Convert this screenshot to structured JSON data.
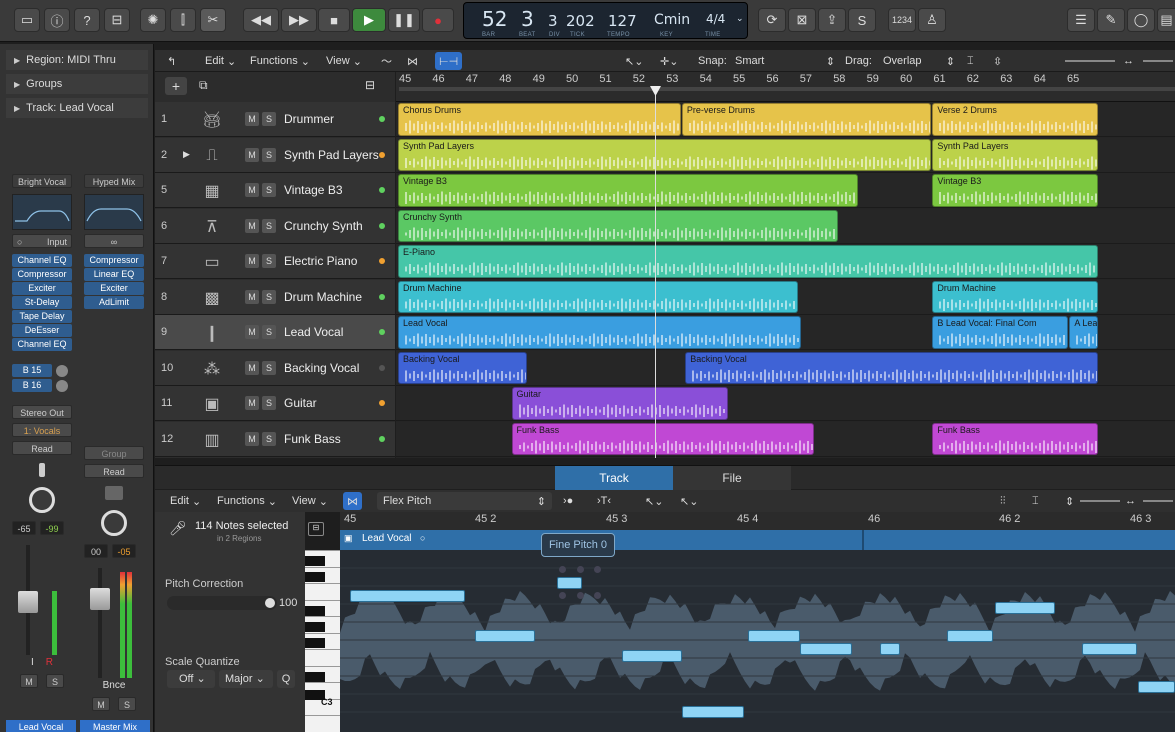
{
  "control_bar": {
    "lcd": {
      "bar": "52",
      "beat": "3",
      "div": "3",
      "tick": "202",
      "tempo": "127",
      "key": "Cmin",
      "time_sig": "4/4"
    },
    "lcd_labels": {
      "bar": "BAR",
      "beat": "BEAT",
      "div": "DIV",
      "tick": "TICK",
      "tempo": "TEMPO",
      "key": "KEY",
      "time": "TIME"
    },
    "count_in_label": "1234"
  },
  "inspector": {
    "region_label": "Region:",
    "region_value": "MIDI Thru",
    "groups_label": "Groups",
    "track_label": "Track:",
    "track_value": "Lead Vocal",
    "strip1": {
      "setting": "Bright Vocal",
      "input": "Input",
      "plugins": [
        "Channel EQ",
        "Compressor",
        "Exciter",
        "St-Delay",
        "Tape Delay",
        "DeEsser",
        "Channel EQ"
      ],
      "sends": [
        "B 15",
        "B 16"
      ],
      "output": "Stereo Out",
      "group": "1: Vocals",
      "automation": "Read",
      "pan_values": [
        "-65",
        "-99"
      ],
      "ir_labels": [
        "I",
        "R"
      ],
      "ms": [
        "M",
        "S"
      ],
      "name": "Lead Vocal"
    },
    "strip2": {
      "setting": "Hyped Mix",
      "plugins": [
        "Compressor",
        "Linear EQ",
        "Exciter",
        "AdLimit"
      ],
      "group": "Group",
      "automation": "Read",
      "pan_values": [
        "00",
        "-05"
      ],
      "bounce": "Bnce",
      "ms": [
        "M",
        "S"
      ],
      "name": "Master Mix"
    }
  },
  "tracks_toolbar": {
    "edit": "Edit",
    "functions": "Functions",
    "view": "View",
    "snap_label": "Snap:",
    "snap_value": "Smart",
    "drag_label": "Drag:",
    "drag_value": "Overlap"
  },
  "ruler": [
    "45",
    "46",
    "47",
    "48",
    "49",
    "50",
    "51",
    "52",
    "53",
    "54",
    "55",
    "56",
    "57",
    "58",
    "59",
    "60",
    "61",
    "62",
    "63",
    "64",
    "65"
  ],
  "tracks": [
    {
      "num": "1",
      "name": "Drummer",
      "icon": "drum-kit-icon",
      "dot": "#5fd15f"
    },
    {
      "num": "2",
      "name": "Synth Pad Layers",
      "icon": "synth-icon",
      "dot": "#f0a030"
    },
    {
      "num": "5",
      "name": "Vintage B3",
      "icon": "organ-icon",
      "dot": "#5fd15f"
    },
    {
      "num": "6",
      "name": "Crunchy Synth",
      "icon": "synth-stand-icon",
      "dot": "#5fd15f"
    },
    {
      "num": "7",
      "name": "Electric Piano",
      "icon": "piano-icon",
      "dot": "#f0a030"
    },
    {
      "num": "8",
      "name": "Drum Machine",
      "icon": "drum-machine-icon",
      "dot": "#5fd15f"
    },
    {
      "num": "9",
      "name": "Lead Vocal",
      "icon": "microphone-icon",
      "dot": "#5fd15f"
    },
    {
      "num": "10",
      "name": "Backing Vocal",
      "icon": "choir-icon",
      "dot": "#555555"
    },
    {
      "num": "11",
      "name": "Guitar",
      "icon": "amp-icon",
      "dot": "#f0a030"
    },
    {
      "num": "12",
      "name": "Funk Bass",
      "icon": "bass-amp-icon",
      "dot": "#5fd15f"
    }
  ],
  "regions": [
    {
      "lane": 0,
      "start": 45,
      "end": 53.5,
      "name": "Chorus Drums",
      "color": "#e6c34a"
    },
    {
      "lane": 0,
      "start": 53.5,
      "end": 61,
      "name": "Pre-verse Drums",
      "color": "#e6c34a"
    },
    {
      "lane": 0,
      "start": 61,
      "end": 66,
      "name": "Verse 2 Drums",
      "color": "#e6c34a"
    },
    {
      "lane": 1,
      "start": 45,
      "end": 61,
      "name": "Synth Pad Layers",
      "color": "#bcd24a"
    },
    {
      "lane": 1,
      "start": 61,
      "end": 66,
      "name": "Synth Pad Layers",
      "color": "#bcd24a"
    },
    {
      "lane": 2,
      "start": 45,
      "end": 58.8,
      "name": "Vintage B3",
      "color": "#7cc840"
    },
    {
      "lane": 2,
      "start": 61,
      "end": 66,
      "name": "Vintage B3",
      "color": "#7cc840"
    },
    {
      "lane": 3,
      "start": 45,
      "end": 58.2,
      "name": "Crunchy Synth",
      "color": "#5bc864"
    },
    {
      "lane": 4,
      "start": 45,
      "end": 66,
      "name": "E-Piano",
      "color": "#45c6a8"
    },
    {
      "lane": 5,
      "start": 45,
      "end": 57,
      "name": "Drum Machine",
      "color": "#3cbfcf"
    },
    {
      "lane": 5,
      "start": 61,
      "end": 66,
      "name": "Drum Machine",
      "color": "#3cbfcf"
    },
    {
      "lane": 6,
      "start": 45,
      "end": 57.1,
      "name": "Lead Vocal",
      "color": "#3a9ee0"
    },
    {
      "lane": 6,
      "start": 61,
      "end": 65.1,
      "name": "B  Lead Vocal: Final Com",
      "color": "#3a9ee0"
    },
    {
      "lane": 6,
      "start": 65.1,
      "end": 66,
      "name": "A  Lead Vocal: Final",
      "color": "#3a9ee0"
    },
    {
      "lane": 7,
      "start": 45,
      "end": 48.9,
      "name": "Backing Vocal",
      "color": "#3f63d6"
    },
    {
      "lane": 7,
      "start": 53.6,
      "end": 66,
      "name": "Backing Vocal",
      "color": "#3f63d6"
    },
    {
      "lane": 8,
      "start": 48.4,
      "end": 54.9,
      "name": "Guitar",
      "color": "#8a4fd8"
    },
    {
      "lane": 9,
      "start": 48.4,
      "end": 57.5,
      "name": "Funk Bass",
      "color": "#c048d4"
    },
    {
      "lane": 9,
      "start": 61,
      "end": 66,
      "name": "Funk Bass",
      "color": "#c048d4"
    }
  ],
  "editor": {
    "tabs": [
      "Track",
      "File"
    ],
    "edit": "Edit",
    "functions": "Functions",
    "view": "View",
    "mode": "Flex Pitch",
    "notes_selected": "114 Notes selected",
    "in_regions": "in 2 Regions",
    "pitch_correction_label": "Pitch Correction",
    "pitch_correction_value": "100",
    "scale_quantize_label": "Scale Quantize",
    "sq_off": "Off",
    "sq_scale": "Major",
    "sq_q": "Q",
    "key_label": "C3",
    "ruler": [
      "45",
      "45 2",
      "45 3",
      "45 4",
      "46",
      "46 2",
      "46 3"
    ],
    "region_name": "Lead Vocal",
    "tooltip": "Fine Pitch  0"
  },
  "colors": {
    "accent": "#3a8fd6",
    "record": "#e0303a",
    "play": "#3a8a3a"
  }
}
